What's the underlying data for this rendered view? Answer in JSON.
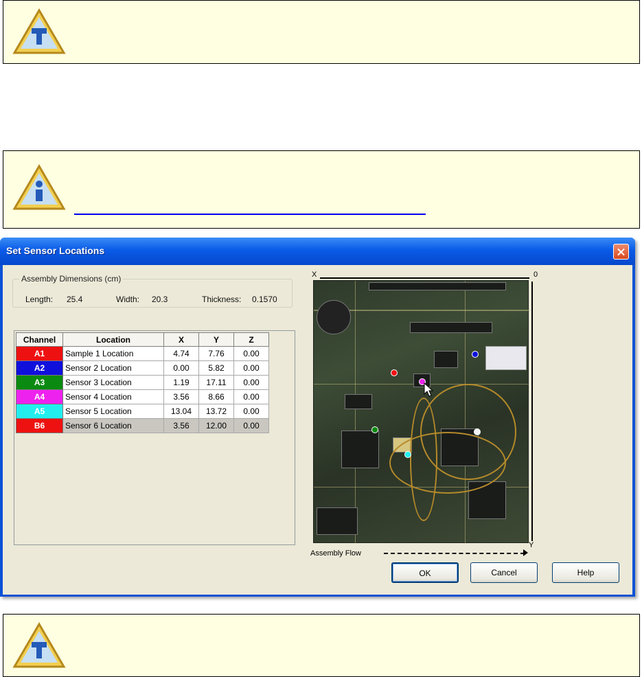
{
  "notices": [
    {
      "icon": "tool-icon"
    },
    {
      "icon": "info-icon",
      "has_link": true
    },
    {
      "icon": "tool-icon"
    }
  ],
  "dialog": {
    "title": "Set Sensor Locations",
    "assembly": {
      "legend": "Assembly Dimensions (cm)",
      "length_label": "Length:",
      "length_value": "25.4",
      "width_label": "Width:",
      "width_value": "20.3",
      "thickness_label": "Thickness:",
      "thickness_value": "0.1570"
    },
    "table": {
      "headers": [
        "Channel",
        "Location",
        "X",
        "Y",
        "Z"
      ],
      "rows": [
        {
          "channel": "A1",
          "color": "#ee1111",
          "location": "Sample 1 Location",
          "x": "4.74",
          "y": "7.76",
          "z": "0.00"
        },
        {
          "channel": "A2",
          "color": "#1010dd",
          "location": "Sensor 2 Location",
          "x": "0.00",
          "y": "5.82",
          "z": "0.00"
        },
        {
          "channel": "A3",
          "color": "#0a8a10",
          "location": "Sensor 3 Location",
          "x": "1.19",
          "y": "17.11",
          "z": "0.00"
        },
        {
          "channel": "A4",
          "color": "#ee22ee",
          "location": "Sensor 4 Location",
          "x": "3.56",
          "y": "8.66",
          "z": "0.00"
        },
        {
          "channel": "A5",
          "color": "#22eeee",
          "location": "Sensor 5 Location",
          "x": "13.04",
          "y": "13.72",
          "z": "0.00"
        },
        {
          "channel": "B6",
          "color": "#ee1111",
          "location": "Sensor 6 Location",
          "x": "3.56",
          "y": "12.00",
          "z": "0.00"
        }
      ]
    },
    "board": {
      "x_label": "X",
      "origin_label": "0",
      "y_label": "Y",
      "flow_label": "Assembly Flow"
    },
    "buttons": {
      "ok": "OK",
      "cancel": "Cancel",
      "help": "Help"
    }
  }
}
